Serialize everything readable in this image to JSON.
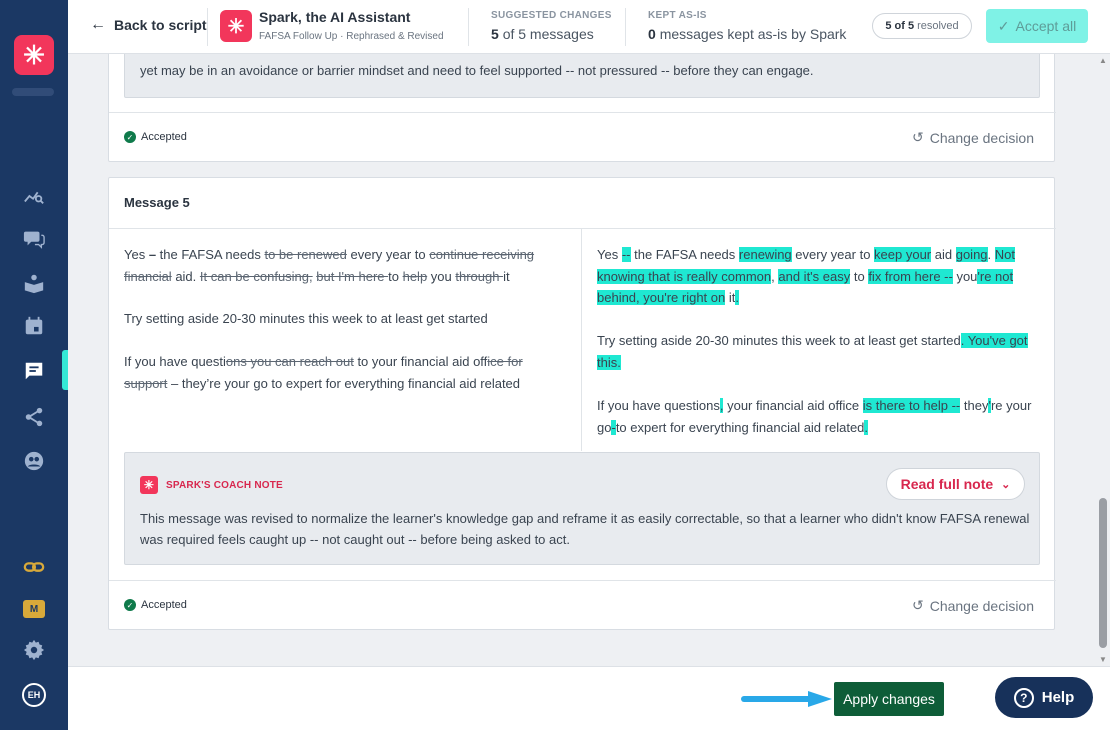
{
  "header": {
    "back_label": "Back to script",
    "title": "Spark, the AI Assistant",
    "subtitle": "FAFSA Follow Up · Rephrased & Revised",
    "suggested": {
      "label": "SUGGESTED CHANGES",
      "count": "5",
      "rest": "of 5 messages"
    },
    "kept": {
      "label": "KEPT AS-IS",
      "count": "0",
      "rest": "messages kept as-is by Spark"
    },
    "resolved": {
      "count": "5 of 5",
      "rest": "resolved"
    },
    "accept_all_label": "Accept all"
  },
  "prev_card": {
    "note_text": "yet may be in an avoidance or barrier mindset and need to feel supported -- not pressured -- before they can engage.",
    "status": "Accepted",
    "change_decision": "Change decision"
  },
  "message": {
    "title": "Message 5",
    "original": {
      "p1": [
        {
          "t": "Yes ",
          "k": ""
        },
        {
          "t": "–",
          "k": "b"
        },
        {
          "t": " the FAFSA needs ",
          "k": ""
        },
        {
          "t": "to be renewed",
          "k": "del"
        },
        {
          "t": " every year to ",
          "k": ""
        },
        {
          "t": "continue receiving financial",
          "k": "del"
        },
        {
          "t": " aid. ",
          "k": ""
        },
        {
          "t": "It can be confusing,",
          "k": "del"
        },
        {
          "t": " ",
          "k": ""
        },
        {
          "t": "but I'm here ",
          "k": "del"
        },
        {
          "t": "to ",
          "k": ""
        },
        {
          "t": "help",
          "k": "del"
        },
        {
          "t": " you ",
          "k": ""
        },
        {
          "t": "through ",
          "k": "del"
        },
        {
          "t": "it",
          "k": ""
        }
      ],
      "p2": [
        {
          "t": "Try setting aside 20-30 minutes this week to at least get started",
          "k": ""
        }
      ],
      "p3": [
        {
          "t": "If you have questi",
          "k": ""
        },
        {
          "t": "ons you can reach out",
          "k": "del"
        },
        {
          "t": " to your financial aid off",
          "k": ""
        },
        {
          "t": "ice for support",
          "k": "del"
        },
        {
          "t": " – they’re your go to expert for everything financial aid related",
          "k": ""
        }
      ]
    },
    "revised": {
      "p1": [
        {
          "t": "Yes ",
          "k": ""
        },
        {
          "t": "--",
          "k": "hl"
        },
        {
          "t": " the FAFSA needs ",
          "k": ""
        },
        {
          "t": "renewing",
          "k": "hl"
        },
        {
          "t": " every year to ",
          "k": ""
        },
        {
          "t": "keep your",
          "k": "hl"
        },
        {
          "t": " aid ",
          "k": ""
        },
        {
          "t": "going",
          "k": "hl"
        },
        {
          "t": ". ",
          "k": ""
        },
        {
          "t": "Not knowing that is really common",
          "k": "hl"
        },
        {
          "t": ", ",
          "k": ""
        },
        {
          "t": "and it's easy",
          "k": "hl"
        },
        {
          "t": " to ",
          "k": ""
        },
        {
          "t": "fix from here --",
          "k": "hl"
        },
        {
          "t": " you",
          "k": ""
        },
        {
          "t": "'re not behind, you're right on",
          "k": "hl"
        },
        {
          "t": " it",
          "k": ""
        },
        {
          "t": ".",
          "k": "hl"
        }
      ],
      "p2": [
        {
          "t": "Try setting aside 20-30 minutes this week to at least get started",
          "k": ""
        },
        {
          "t": ". You've got this.",
          "k": "hl"
        }
      ],
      "p3": [
        {
          "t": "If you have questions",
          "k": ""
        },
        {
          "t": ",",
          "k": "hl"
        },
        {
          "t": " your financial aid office ",
          "k": ""
        },
        {
          "t": "is there to help --",
          "k": "hl"
        },
        {
          "t": " they",
          "k": ""
        },
        {
          "t": "'",
          "k": "hl"
        },
        {
          "t": "re your go",
          "k": ""
        },
        {
          "t": "-",
          "k": "hl"
        },
        {
          "t": "to expert for everything financial aid related",
          "k": ""
        },
        {
          "t": ".",
          "k": "hl"
        }
      ]
    },
    "coach": {
      "label": "SPARK'S COACH NOTE",
      "read_label": "Read full note",
      "text": "This message was revised to normalize the learner's knowledge gap and reframe it as easily correctable, so that a learner who didn't know FAFSA renewal was required feels caught up -- not caught out -- before being asked to act."
    },
    "status": "Accepted",
    "change_decision": "Change decision"
  },
  "sidebar": {
    "badge": "M",
    "avatar": "EH"
  },
  "footer": {
    "apply_label": "Apply changes",
    "help_label": "Help"
  },
  "colors": {
    "highlight": "#1fe8d2",
    "brand": "#f2365b",
    "apply": "#0e5d38",
    "rail": "#1b3864"
  }
}
